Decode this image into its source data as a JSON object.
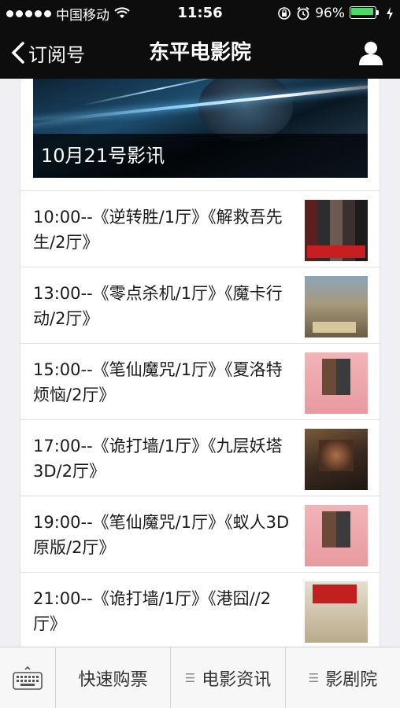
{
  "status_bar": {
    "carrier": "中国移动",
    "time": "11:56",
    "battery": "96%",
    "battery_level": 0.96
  },
  "nav": {
    "back_label": "订阅号",
    "title": "东平电影院"
  },
  "banner": {
    "caption": "10月21号影讯"
  },
  "schedule": [
    {
      "text": "10:00--《逆转胜/1厅》《解救吾先生/2厅》"
    },
    {
      "text": "13:00--《零点杀机/1厅》《魔卡行动/2厅》"
    },
    {
      "text": "15:00--《笔仙魔咒/1厅》《夏洛特烦恼/2厅》"
    },
    {
      "text": "17:00--《诡打墙/1厅》《九层妖塔3D/2厅》"
    },
    {
      "text": "19:00--《笔仙魔咒/1厅》《蚁人3D原版/2厅》"
    },
    {
      "text": "21:00--《诡打墙/1厅》《港囧//2厅》"
    }
  ],
  "bottom_menu": {
    "items": [
      {
        "label": "快速购票",
        "has_menu_icon": false
      },
      {
        "label": "电影资讯",
        "has_menu_icon": true
      },
      {
        "label": "影剧院",
        "has_menu_icon": true
      }
    ]
  },
  "colors": {
    "bar_bg": "#0d0d0d",
    "battery_green": "#4cd964",
    "page_bg": "#efeff4"
  }
}
